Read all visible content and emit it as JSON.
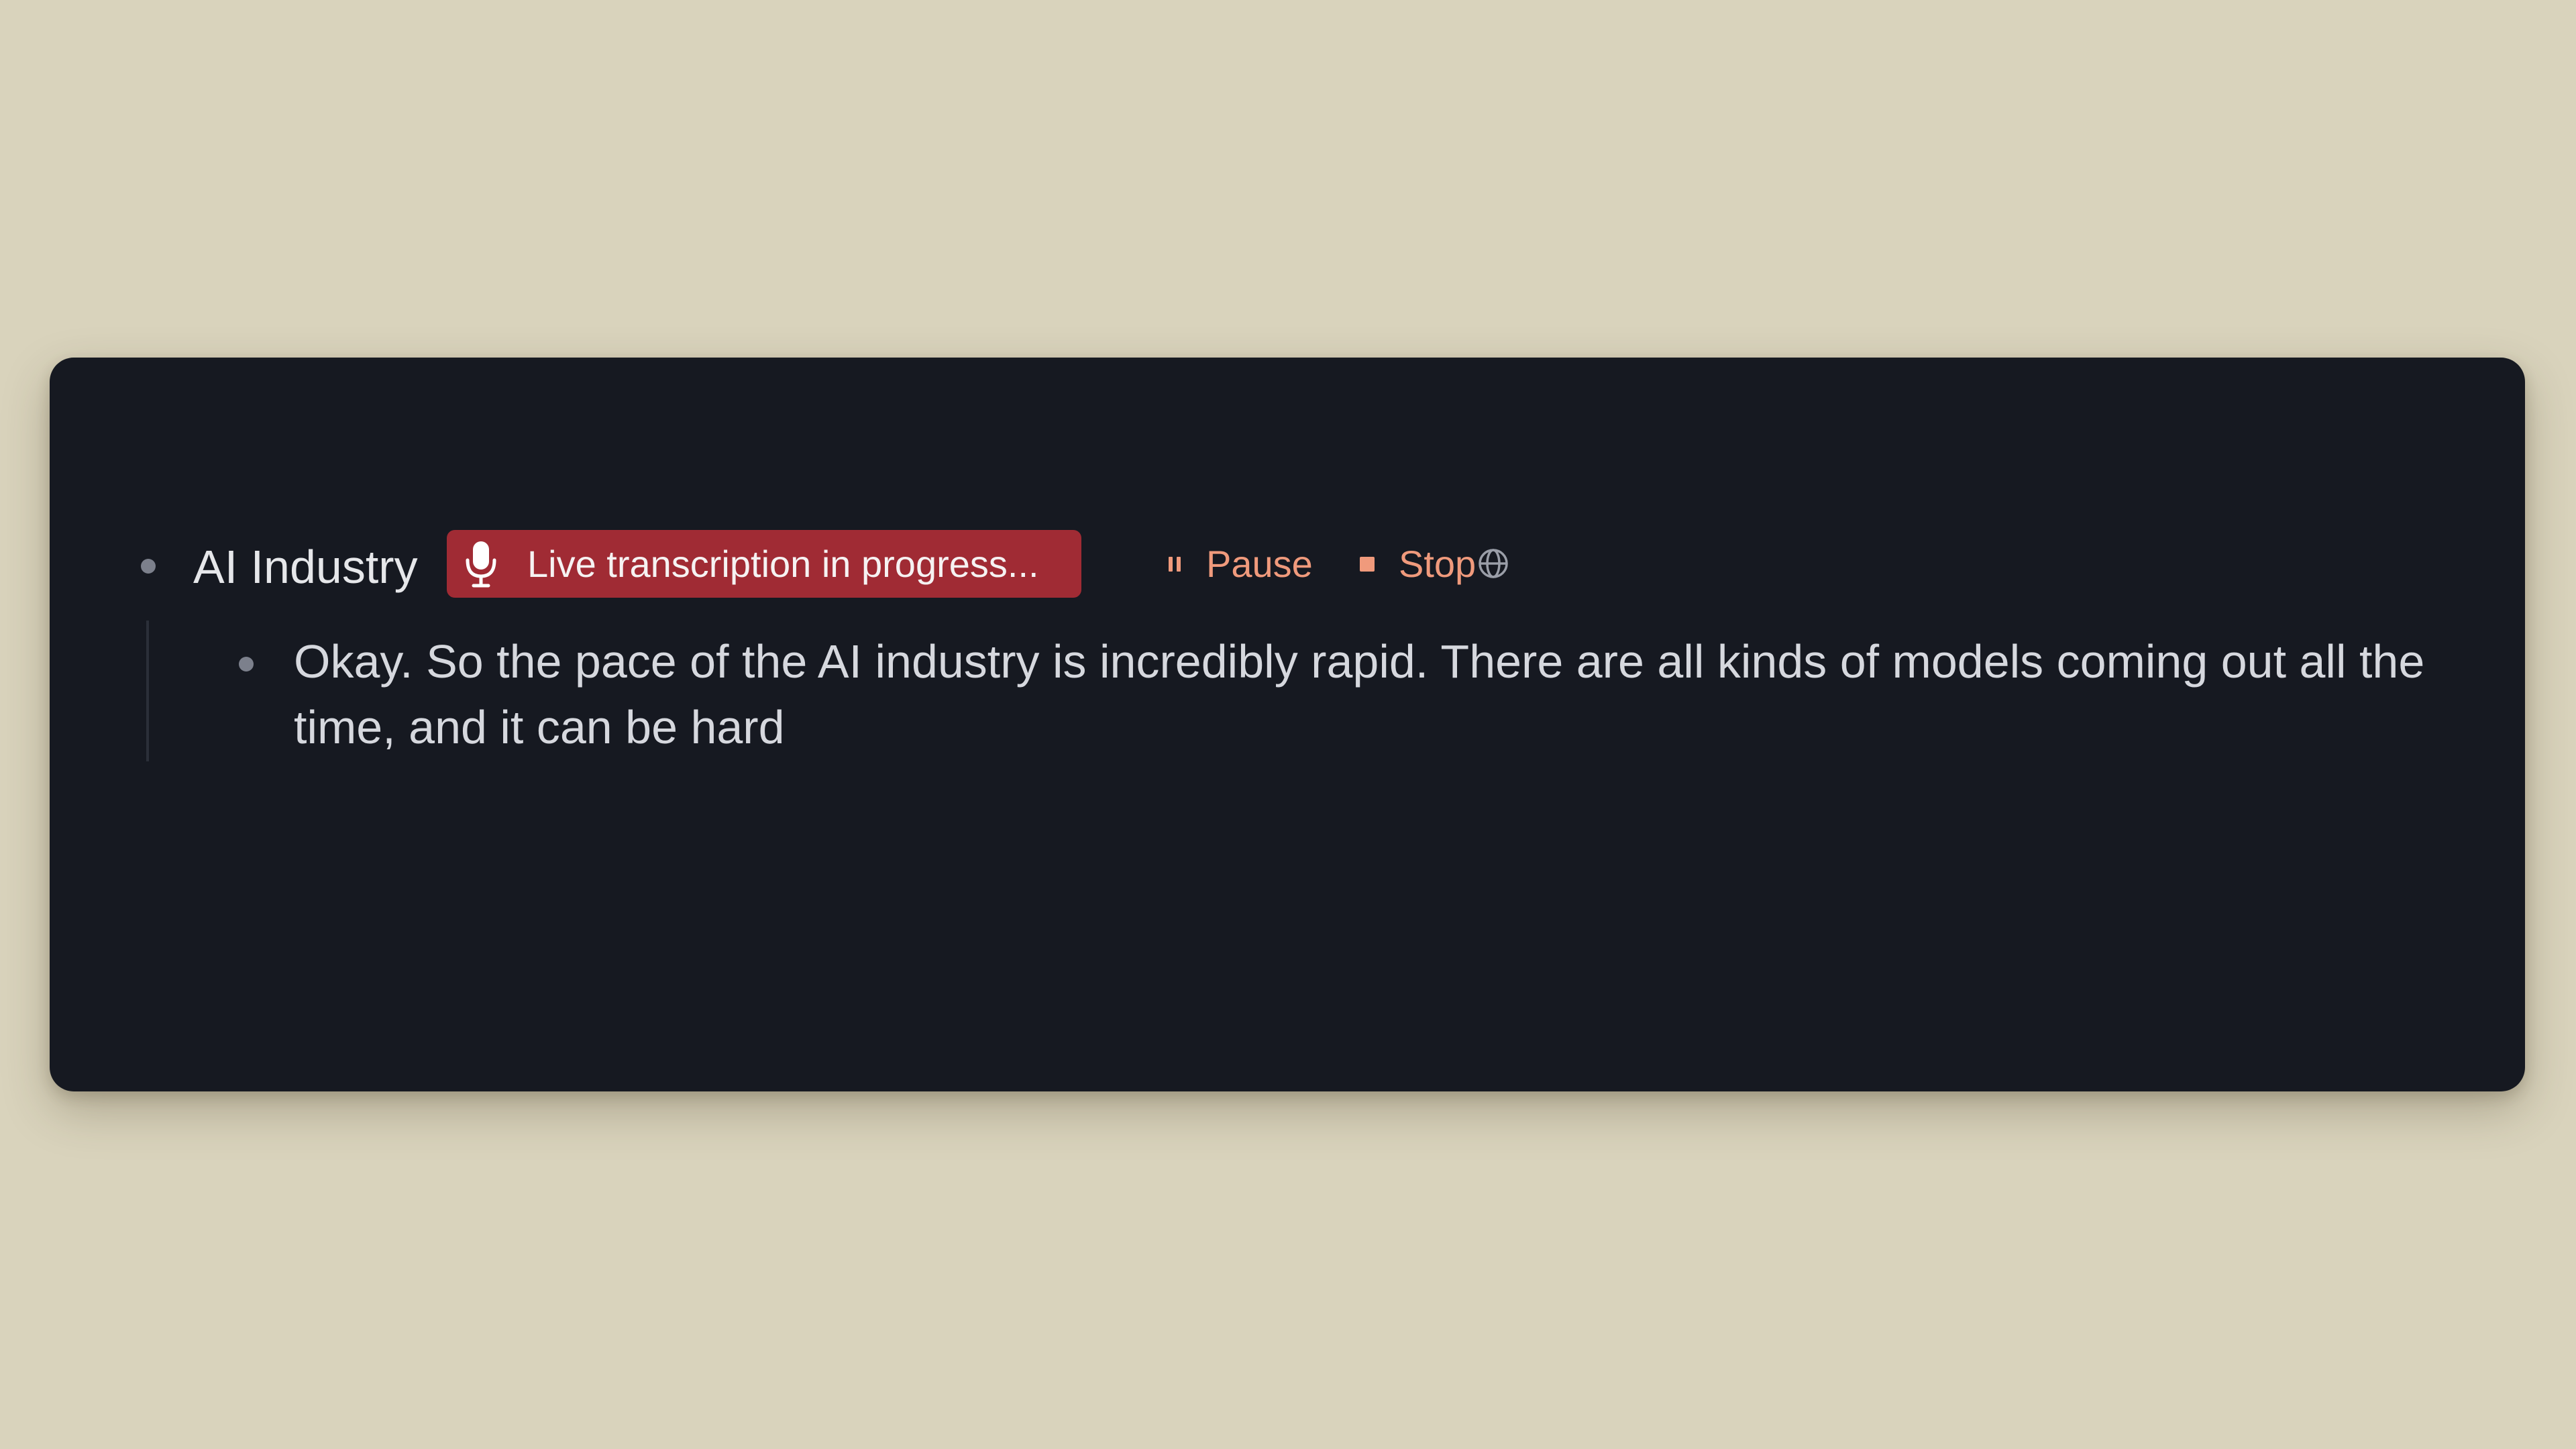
{
  "outline": {
    "parent": {
      "title": "AI Industry"
    },
    "transcription": {
      "badge_label": "Live transcription in progress...",
      "mic_icon": "microphone-icon",
      "pause_label": "Pause",
      "pause_icon": "pause-icon",
      "stop_label": "Stop",
      "stop_icon": "stop-icon",
      "language_icon": "globe-icon"
    },
    "child": {
      "text": "Okay. So the pace of the AI industry is incredibly rapid. There are all kinds of models coming out all the time, and it can be hard"
    }
  },
  "colors": {
    "page_background": "#d9d3bc",
    "card_background": "#161921",
    "badge_background": "#a02b34",
    "control_accent": "#f09a7c"
  }
}
